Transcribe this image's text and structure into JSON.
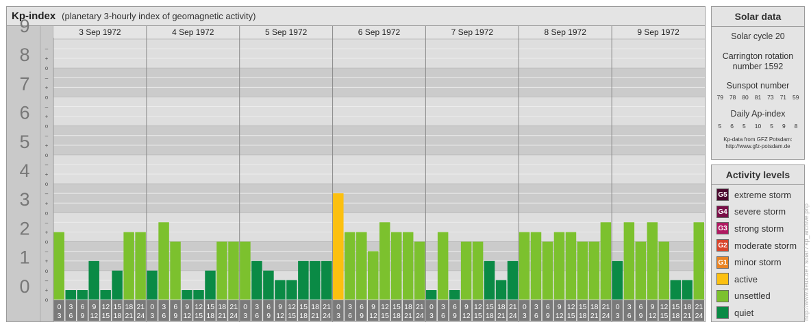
{
  "header": {
    "title": "Kp-index",
    "subtitle": "(planetary 3-hourly index of geomagnetic activity)"
  },
  "chart_data": {
    "type": "bar",
    "title": "Kp-index",
    "subtitle": "(planetary 3-hourly index of geomagnetic activity)",
    "ylim": [
      0,
      9
    ],
    "y_ticks": [
      "0",
      "1",
      "2",
      "3",
      "4",
      "5",
      "6",
      "7",
      "8",
      "9"
    ],
    "y_minor_ticks": [
      "+",
      "o",
      "–"
    ],
    "x_tick_labels": [
      [
        "0",
        "3"
      ],
      [
        "3",
        "6"
      ],
      [
        "6",
        "9"
      ],
      [
        "9",
        "12"
      ],
      [
        "12",
        "15"
      ],
      [
        "15",
        "18"
      ],
      [
        "18",
        "21"
      ],
      [
        "21",
        "24"
      ]
    ],
    "days": [
      {
        "date": "3 Sep 1972",
        "values": [
          2.33,
          0.33,
          0.33,
          1.33,
          0.33,
          1.0,
          2.33,
          2.33
        ],
        "levels": [
          "unsettled",
          "quiet",
          "quiet",
          "quiet",
          "quiet",
          "quiet",
          "unsettled",
          "unsettled"
        ]
      },
      {
        "date": "4 Sep 1972",
        "values": [
          1.0,
          2.67,
          2.0,
          0.33,
          0.33,
          1.0,
          2.0,
          2.0
        ],
        "levels": [
          "quiet",
          "unsettled",
          "unsettled",
          "quiet",
          "quiet",
          "quiet",
          "unsettled",
          "unsettled"
        ]
      },
      {
        "date": "5 Sep 1972",
        "values": [
          2.0,
          1.33,
          1.0,
          0.67,
          0.67,
          1.33,
          1.33,
          1.33
        ],
        "levels": [
          "unsettled",
          "quiet",
          "quiet",
          "quiet",
          "quiet",
          "quiet",
          "quiet",
          "quiet"
        ]
      },
      {
        "date": "6 Sep 1972",
        "values": [
          3.67,
          2.33,
          2.33,
          1.67,
          2.67,
          2.33,
          2.33,
          2.0
        ],
        "levels": [
          "active",
          "unsettled",
          "unsettled",
          "unsettled",
          "unsettled",
          "unsettled",
          "unsettled",
          "unsettled"
        ]
      },
      {
        "date": "7 Sep 1972",
        "values": [
          0.33,
          2.33,
          0.33,
          2.0,
          2.0,
          1.33,
          0.67,
          1.33
        ],
        "levels": [
          "quiet",
          "unsettled",
          "quiet",
          "unsettled",
          "unsettled",
          "quiet",
          "quiet",
          "quiet"
        ]
      },
      {
        "date": "8 Sep 1972",
        "values": [
          2.33,
          2.33,
          2.0,
          2.33,
          2.33,
          2.0,
          2.0,
          2.67
        ],
        "levels": [
          "unsettled",
          "unsettled",
          "unsettled",
          "unsettled",
          "unsettled",
          "unsettled",
          "unsettled",
          "unsettled"
        ]
      },
      {
        "date": "9 Sep 1972",
        "values": [
          1.33,
          2.67,
          2.0,
          2.67,
          2.0,
          0.67,
          0.67,
          2.67
        ],
        "levels": [
          "quiet",
          "unsettled",
          "unsettled",
          "unsettled",
          "unsettled",
          "quiet",
          "quiet",
          "unsettled"
        ]
      }
    ],
    "grid": true
  },
  "solar": {
    "title": "Solar data",
    "cycle": "Solar cycle 20",
    "carrington_line1": "Carrington rotation",
    "carrington_line2": "number 1592",
    "sunspot_label": "Sunspot number",
    "sunspots": [
      "79",
      "78",
      "80",
      "81",
      "73",
      "71",
      "59"
    ],
    "ap_label": "Daily Ap-index",
    "ap": [
      "5",
      "6",
      "5",
      "10",
      "5",
      "9",
      "8"
    ],
    "credit_line1": "Kp-data from GFZ Potsdam:",
    "credit_line2": "http://www.gfz-potsdam.de"
  },
  "levels": {
    "title": "Activity levels",
    "items": [
      {
        "code": "G5",
        "label": "extreme storm",
        "color": "#4a0a2e"
      },
      {
        "code": "G4",
        "label": "severe storm",
        "color": "#7a1048"
      },
      {
        "code": "G3",
        "label": "strong storm",
        "color": "#b01a62"
      },
      {
        "code": "G2",
        "label": "moderate storm",
        "color": "#d9442b"
      },
      {
        "code": "G1",
        "label": "minor storm",
        "color": "#e98424"
      },
      {
        "code": "",
        "label": "active",
        "color": "#fcc010"
      },
      {
        "code": "",
        "label": "unsettled",
        "color": "#7cc12e"
      },
      {
        "code": "",
        "label": "quiet",
        "color": "#0a8a45"
      }
    ]
  },
  "level_colors": {
    "quiet": "#0a8a45",
    "unsettled": "#7cc12e",
    "active": "#fcc010"
  },
  "watermark": "http://www.fleux.de / solar / kp_archive.php"
}
